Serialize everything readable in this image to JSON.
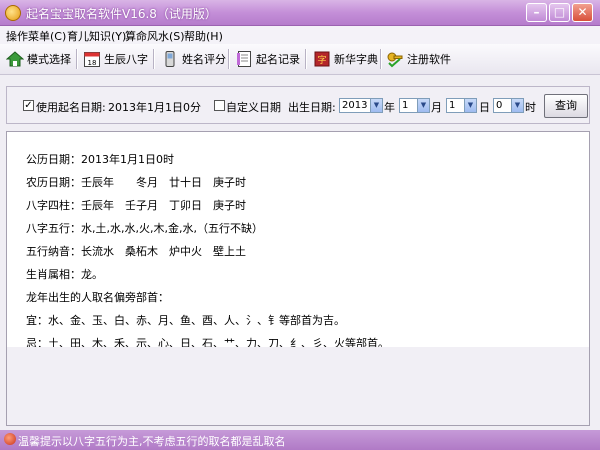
{
  "window": {
    "title": "起名宝宝取名软件V16.8（试用版）",
    "controls": {
      "minimize": "–",
      "maximize": "□",
      "close": "✕"
    }
  },
  "menu": [
    {
      "label": "操作菜单(C)"
    },
    {
      "label": "育儿知识(Y)"
    },
    {
      "label": "算命风水(S)"
    },
    {
      "label": "帮助(H)"
    }
  ],
  "toolbar": [
    {
      "label": "模式选择",
      "icon": "house-icon"
    },
    {
      "label": "生辰八字",
      "icon": "calendar-icon"
    },
    {
      "label": "姓名评分",
      "icon": "phone-icon"
    },
    {
      "label": "起名记录",
      "icon": "notebook-icon"
    },
    {
      "label": "新华字典",
      "icon": "book-icon"
    },
    {
      "label": "注册软件",
      "icon": "key-icon"
    }
  ],
  "options": {
    "use_naming_date": {
      "checked": true,
      "label": "使用起名日期:",
      "value": "2013年1月1日0分"
    },
    "custom_date": {
      "checked": false,
      "label": "自定义日期"
    },
    "birth_date_label": "出生日期:",
    "year": {
      "value": "2013",
      "unit": "年"
    },
    "month": {
      "value": "1",
      "unit": "月"
    },
    "day": {
      "value": "1",
      "unit": "日"
    },
    "hour": {
      "value": "0",
      "unit": "时"
    },
    "query_label": "查询"
  },
  "results": [
    "公历日期：2013年1月1日0时",
    "农历日期：壬辰年　　冬月　廿十日　庚子时",
    "八字四柱：壬辰年　壬子月　丁卯日　庚子时",
    "八字五行：水,土,水,水,火,木,金,水,（五行不缺）",
    "五行纳音：长流水　桑柘木　炉中火　壁上土",
    "生肖属相：龙。",
    "龙年出生的人取名偏旁部首：",
    "宜：水、金、玉、白、赤、月、鱼、酉、人、氵、钅等部首为吉。",
    "忌：土、田、木、禾、示、心、日、石、艹、力、刀、纟、彡、火等部首。"
  ],
  "status": {
    "text": "温馨提示以八字五行为主,不考虑五行的取名都是乱取名"
  },
  "colors": {
    "title_bar": "#c48fd8",
    "status_bar": "#b07ac6",
    "accent_blue": "#7f9db9"
  }
}
